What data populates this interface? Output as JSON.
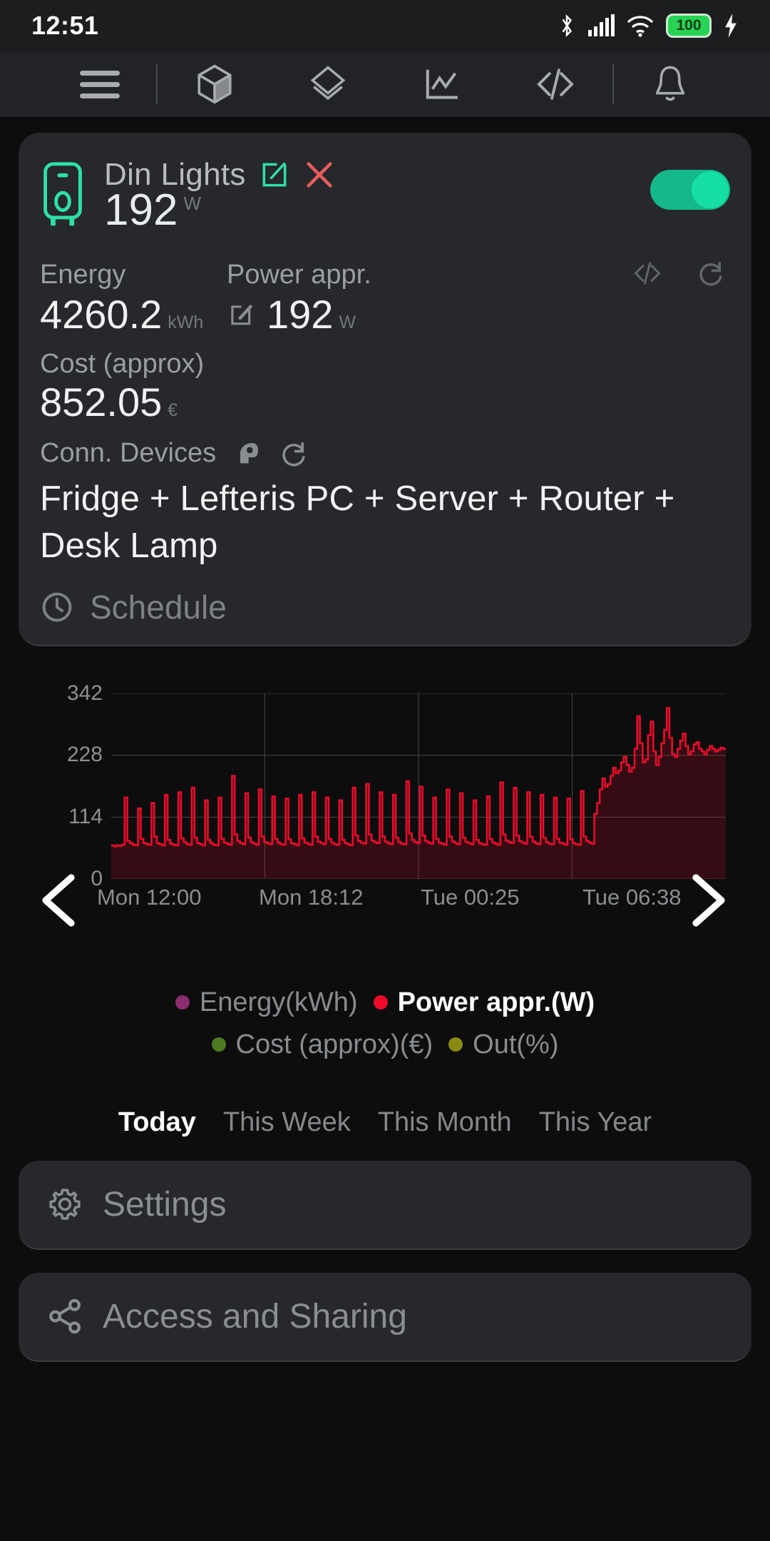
{
  "status_bar": {
    "time": "12:51",
    "battery_level": "100",
    "icons": [
      "bluetooth-icon",
      "cellular-signal-icon",
      "wifi-icon",
      "battery-icon",
      "charging-bolt-icon"
    ]
  },
  "toolbar": {
    "items": [
      {
        "name": "menu-icon",
        "label": "Menu"
      },
      {
        "name": "cube-icon",
        "label": "Devices"
      },
      {
        "name": "layers-icon",
        "label": "Layers"
      },
      {
        "name": "chart-line-icon",
        "label": "Charts"
      },
      {
        "name": "code-icon",
        "label": "Code"
      },
      {
        "name": "bell-icon",
        "label": "Notifications"
      }
    ]
  },
  "device_card": {
    "icon_name": "water-heater-icon",
    "title": "Din Lights",
    "edit_icon": "edit-square-icon",
    "delete_icon": "close-x-icon",
    "power_value": "192",
    "power_unit": "W",
    "toggle_on": true,
    "energy_label": "Energy",
    "energy_value": "4260.2",
    "energy_unit": "kWh",
    "power_label": "Power appr.",
    "power_stat_value": "192",
    "power_stat_unit": "W",
    "power_edit_icon": "edit-pencil-icon",
    "code_icon": "code-icon",
    "refresh_icon": "refresh-icon",
    "cost_label": "Cost (approx)",
    "cost_value": "852.05",
    "cost_unit": "€",
    "conn_label": "Conn. Devices",
    "conn_brain_icon": "head-profile-icon",
    "conn_refresh_icon": "refresh-icon",
    "conn_devices": "Fridge + Lefteris PC + Server + Router + Desk Lamp",
    "schedule_label": "Schedule",
    "schedule_icon": "clock-icon"
  },
  "chart_data": {
    "type": "line",
    "title": "",
    "xlabel": "",
    "ylabel": "",
    "ylim": [
      0,
      342
    ],
    "yticks": [
      "342",
      "228",
      "114",
      "0"
    ],
    "ytick_values": [
      342,
      228,
      114,
      0
    ],
    "xticks": [
      "Mon 12:00",
      "Mon 18:12",
      "Tue 00:25",
      "Tue 06:38"
    ],
    "grid": true,
    "legend_position": "bottom",
    "series": [
      {
        "name": "Power appr.(W)",
        "color": "#ec0b2b",
        "active": true,
        "values": [
          62,
          60,
          62,
          61,
          63,
          150,
          70,
          66,
          63,
          62,
          130,
          74,
          66,
          64,
          63,
          140,
          78,
          66,
          64,
          62,
          155,
          72,
          65,
          63,
          62,
          160,
          75,
          68,
          64,
          63,
          168,
          76,
          66,
          64,
          62,
          145,
          72,
          66,
          63,
          62,
          150,
          74,
          67,
          65,
          63,
          190,
          82,
          70,
          66,
          64,
          158,
          76,
          68,
          65,
          63,
          165,
          78,
          68,
          66,
          64,
          152,
          74,
          67,
          64,
          63,
          148,
          73,
          66,
          64,
          62,
          155,
          75,
          67,
          65,
          63,
          160,
          78,
          69,
          66,
          64,
          150,
          74,
          67,
          64,
          63,
          145,
          72,
          66,
          64,
          62,
          168,
          80,
          70,
          67,
          65,
          175,
          82,
          71,
          68,
          66,
          160,
          78,
          69,
          66,
          64,
          155,
          76,
          68,
          65,
          64,
          180,
          84,
          72,
          68,
          66,
          170,
          80,
          70,
          67,
          65,
          150,
          74,
          67,
          65,
          63,
          165,
          78,
          69,
          66,
          64,
          158,
          76,
          68,
          66,
          64,
          145,
          72,
          66,
          64,
          63,
          152,
          74,
          67,
          65,
          63,
          178,
          82,
          71,
          68,
          66,
          168,
          80,
          70,
          67,
          65,
          160,
          78,
          69,
          66,
          64,
          155,
          76,
          68,
          65,
          64,
          150,
          74,
          67,
          65,
          63,
          148,
          73,
          66,
          64,
          63,
          162,
          78,
          70,
          67,
          65,
          120,
          140,
          165,
          185,
          170,
          175,
          190,
          205,
          195,
          200,
          215,
          225,
          210,
          198,
          205,
          240,
          300,
          250,
          215,
          220,
          265,
          290,
          235,
          210,
          225,
          250,
          275,
          315,
          260,
          230,
          225,
          240,
          255,
          268,
          245,
          230,
          235,
          248,
          252,
          240,
          235,
          230,
          238,
          245,
          240,
          235,
          238,
          242,
          240,
          238
        ]
      },
      {
        "name": "Energy(kWh)",
        "color": "#8c2b6e",
        "active": false,
        "values": []
      },
      {
        "name": "Cost (approx)(€)",
        "color": "#4e7a22",
        "active": false,
        "values": []
      },
      {
        "name": "Out(%)",
        "color": "#8a8a12",
        "active": false,
        "values": []
      }
    ],
    "nav_prev_icon": "chevron-left-icon",
    "nav_next_icon": "chevron-right-icon"
  },
  "legend": {
    "row1": [
      {
        "label": "Energy(kWh)",
        "color": "#8c2b6e",
        "active": false
      },
      {
        "label": "Power appr.(W)",
        "color": "#ec0b2b",
        "active": true
      }
    ],
    "row2": [
      {
        "label": "Cost (approx)(€)",
        "color": "#4e7a22",
        "active": false
      },
      {
        "label": "Out(%)",
        "color": "#8a8a12",
        "active": false
      }
    ]
  },
  "periods": [
    {
      "label": "Today",
      "active": true
    },
    {
      "label": "This Week",
      "active": false
    },
    {
      "label": "This Month",
      "active": false
    },
    {
      "label": "This Year",
      "active": false
    }
  ],
  "bottom_rows": [
    {
      "label": "Settings",
      "icon": "gear-icon"
    },
    {
      "label": "Access and Sharing",
      "icon": "share-icon"
    }
  ],
  "colors": {
    "accent_teal": "#15dfa4",
    "danger_red": "#e85c5c",
    "chart_red": "#ec0b2b",
    "card_bg": "#26282b",
    "page_bg": "#0d0d0e"
  }
}
